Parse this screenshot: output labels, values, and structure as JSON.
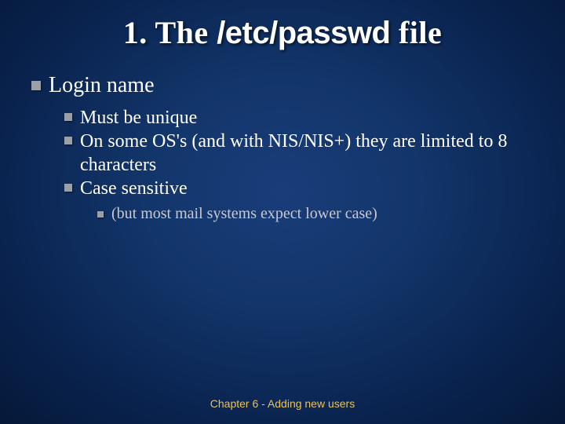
{
  "title_prefix": "1. The ",
  "title_mono": "/etc/passwd",
  "title_suffix": " file",
  "lvl1": "Login name",
  "lvl2": [
    "Must be unique",
    "On some OS's (and with NIS/NIS+) they are limited to 8 characters",
    "Case sensitive"
  ],
  "lvl3": "(but most mail systems expect lower case)",
  "footer": "Chapter 6 - Adding new users"
}
